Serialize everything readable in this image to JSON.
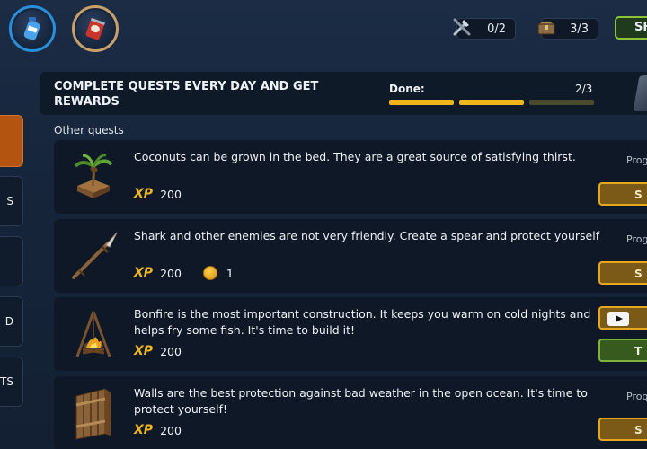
{
  "topbar": {
    "resources": [
      {
        "icon": "water-bottle-icon"
      },
      {
        "icon": "canned-food-icon"
      }
    ],
    "tools_counter": {
      "icon": "tools-icon",
      "value": "0/2"
    },
    "chest_counter": {
      "icon": "chest-icon",
      "value": "3/3"
    },
    "shop_button": {
      "label": "SH"
    }
  },
  "side_tabs": [
    {
      "label": "",
      "active": true
    },
    {
      "label": "S"
    },
    {
      "label": ""
    },
    {
      "label": "D"
    },
    {
      "label": "TS"
    }
  ],
  "header": {
    "title": "COMPLETE QUESTS EVERY DAY AND GET REWARDS",
    "done_label": "Done:",
    "done_count": "2/3",
    "progress": {
      "completed": 2,
      "total": 3
    }
  },
  "section_label": "Other quests",
  "quests": [
    {
      "icon": "palm-planter-icon",
      "description": "Coconuts can be grown in the bed. They are a great source of satisfying thirst.",
      "xp_label": "XP",
      "xp": "200",
      "progress_label": "Prog",
      "button": {
        "label": "S",
        "style": "gold"
      }
    },
    {
      "icon": "spear-icon",
      "description": "Shark and other enemies are not very friendly. Create a spear and protect yourself",
      "xp_label": "XP",
      "xp": "200",
      "coins": "1",
      "progress_label": "Prog",
      "button": {
        "label": "S",
        "style": "gold"
      }
    },
    {
      "icon": "bonfire-icon",
      "description": "Bonfire is the most important construction. It keeps you warm on cold nights and helps fry some fish. It's time to build it!",
      "xp_label": "XP",
      "xp": "200",
      "video_button": {
        "icon": "video-play-icon"
      },
      "button": {
        "label": "T",
        "style": "green"
      }
    },
    {
      "icon": "wooden-wall-icon",
      "description": "Walls are the best protection against bad weather in the open ocean. It's time to protect yourself!",
      "xp_label": "XP",
      "xp": "200",
      "progress_label": "Prog",
      "button": {
        "label": "S",
        "style": "gold"
      }
    }
  ],
  "colors": {
    "accent_gold": "#f0b41c",
    "active_tab": "#b35510",
    "green_button": "#7fb23a",
    "panel": "#0e1827"
  }
}
